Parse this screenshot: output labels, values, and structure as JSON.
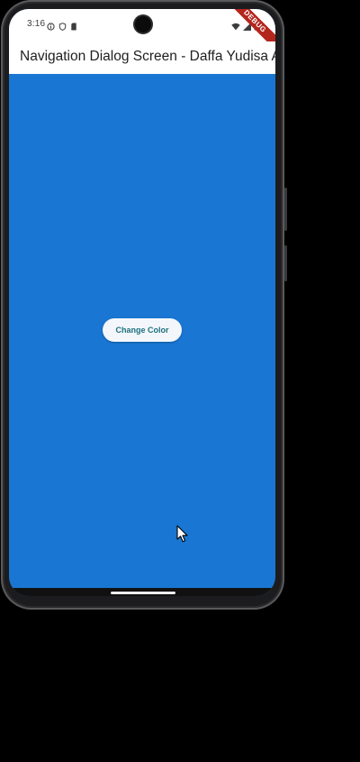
{
  "status_bar": {
    "time": "3:16",
    "left_icons": [
      "info-circle-icon",
      "shield-icon",
      "sim-card-icon"
    ],
    "right_icons": [
      "wifi-icon",
      "signal-icon",
      "battery-icon"
    ],
    "debug_banner": "DEBUG"
  },
  "app_bar": {
    "title": "Navigation Dialog Screen - Daffa Yudisa A"
  },
  "main": {
    "background_color": "#1976d2",
    "button_label": "Change Color"
  },
  "colors": {
    "app_bar": "#ffffff",
    "body": "#1976d2",
    "button_text": "#1e6f7d",
    "debug_banner": "#b3261e"
  }
}
